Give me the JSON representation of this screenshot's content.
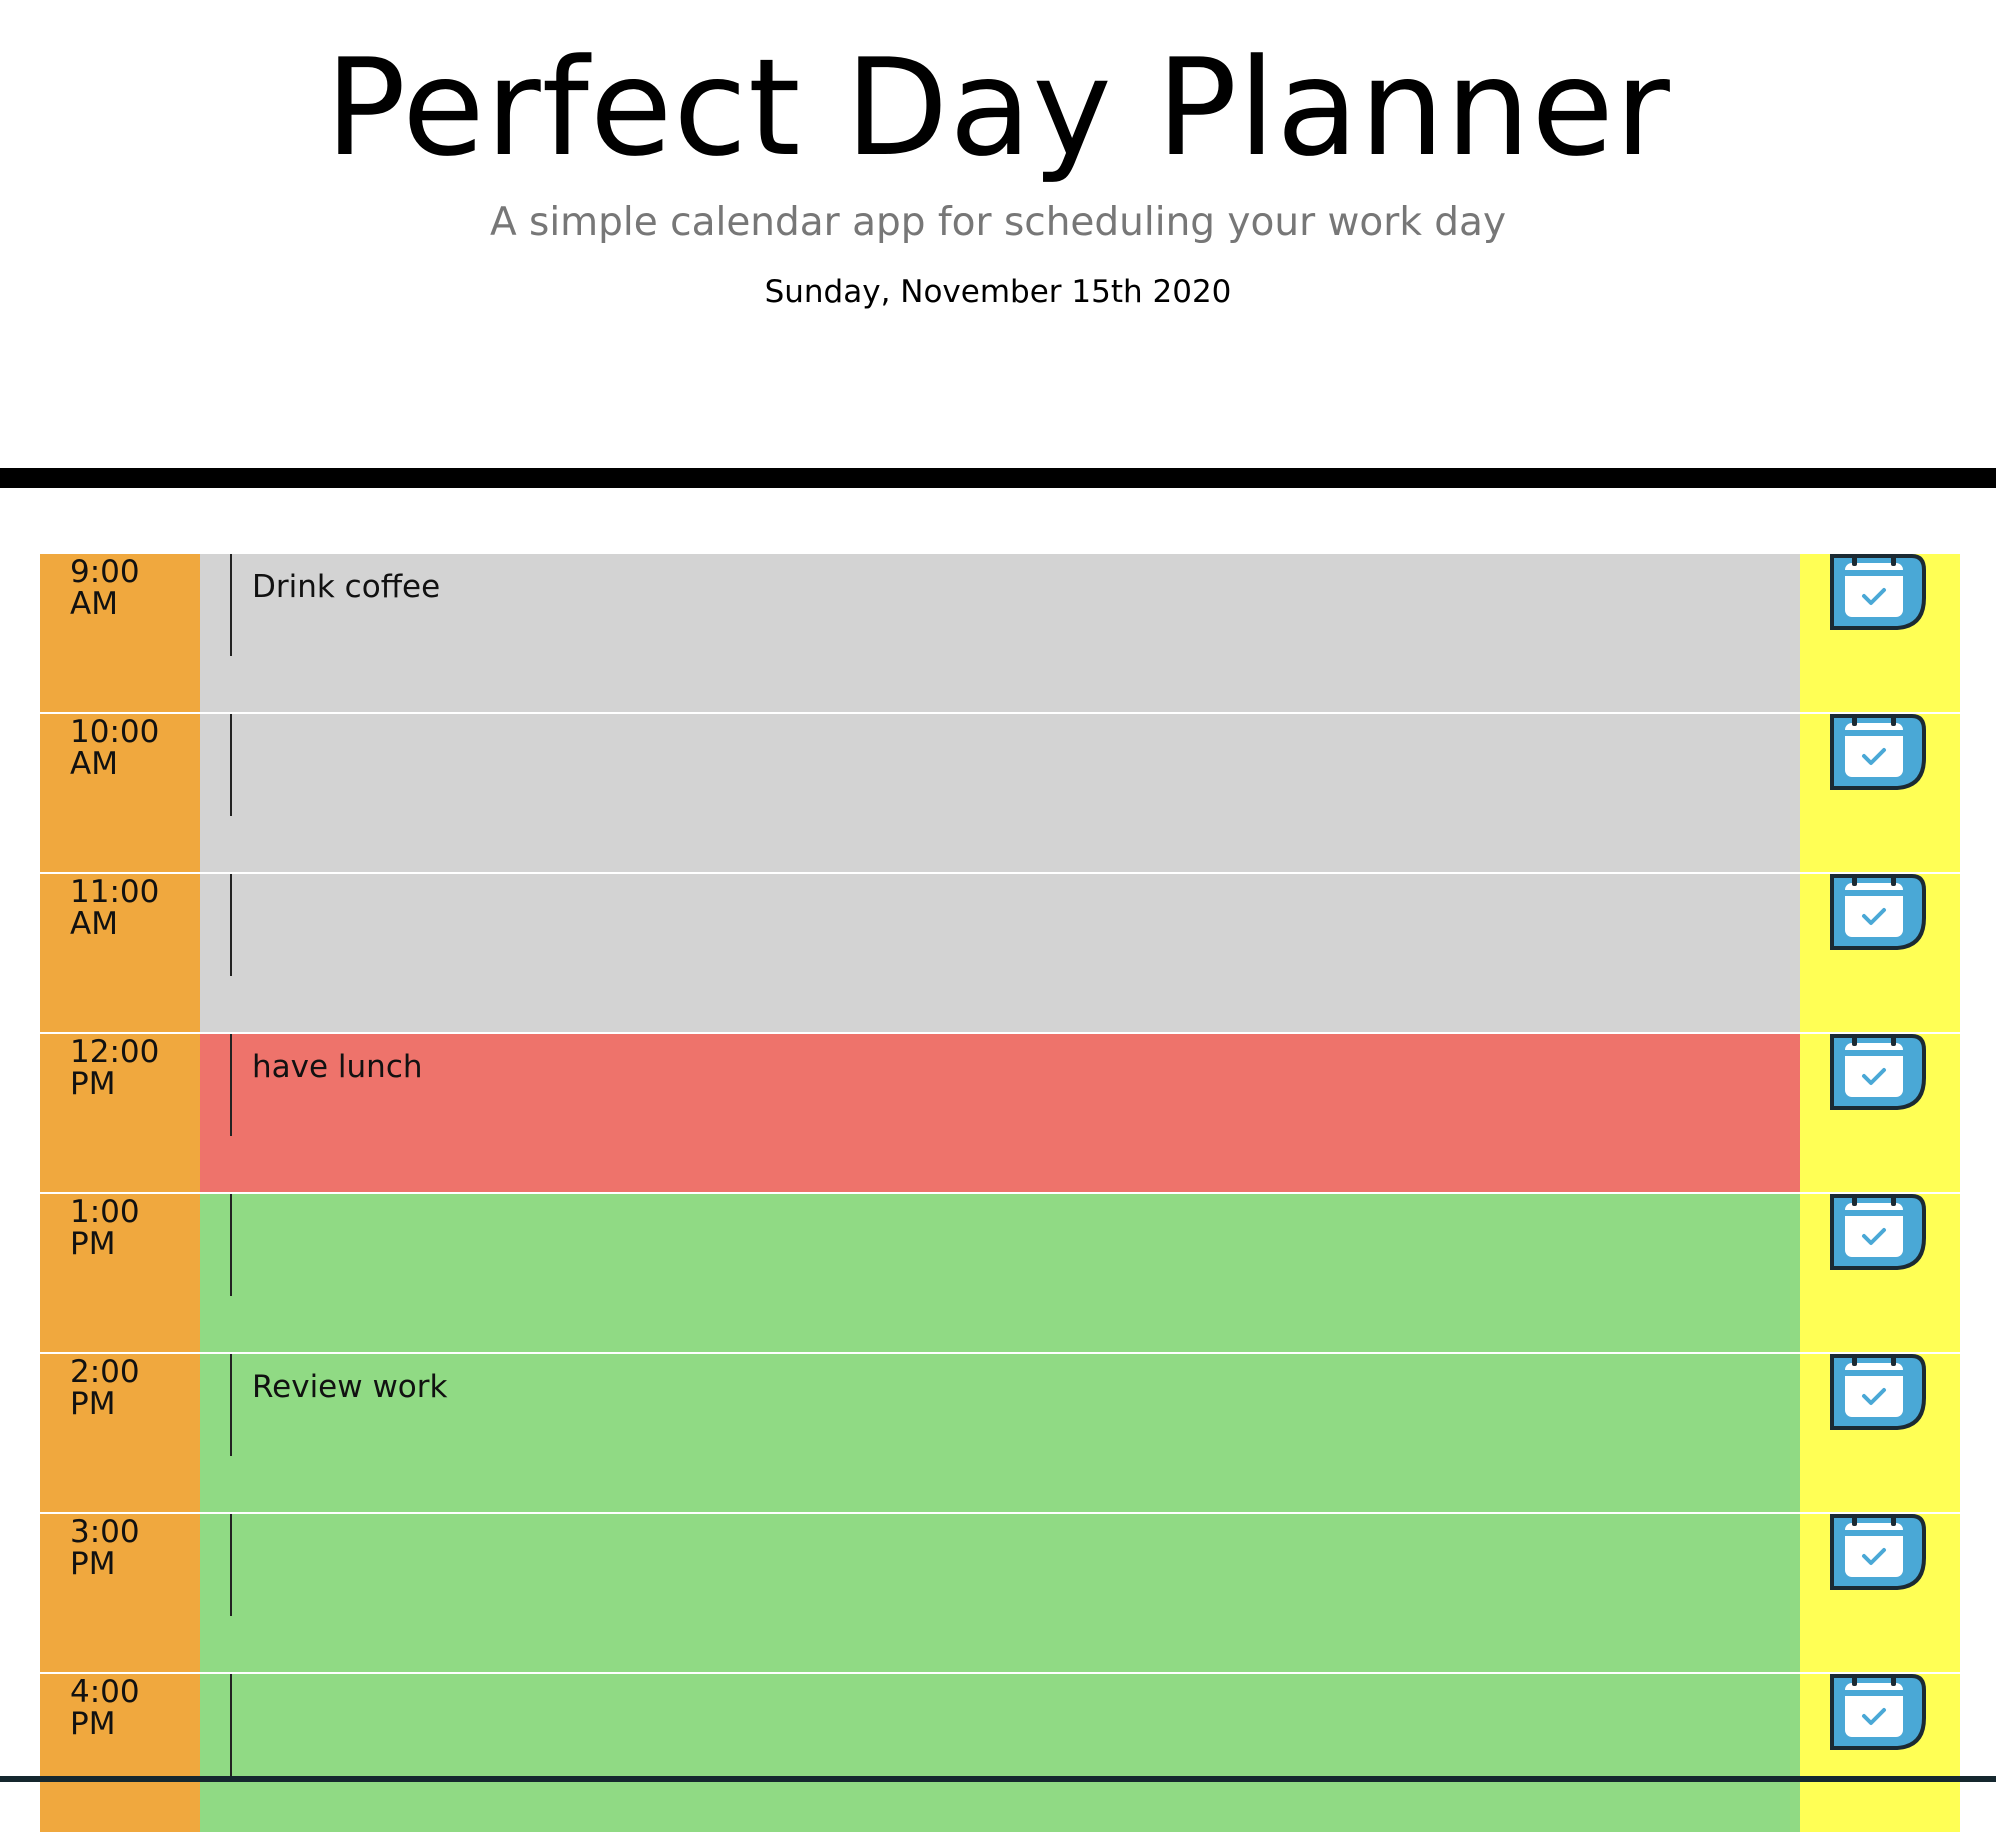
{
  "header": {
    "title": "Perfect Day Planner",
    "subtitle": "A simple calendar app for scheduling your work day",
    "current_date": "Sunday, November 15th 2020"
  },
  "colors": {
    "hour_column": "#f0a83e",
    "past": "#d3d3d3",
    "present": "#ee736b",
    "future": "#90da84",
    "save_column": "#ffff55",
    "save_icon_fill": "#4aa8d6"
  },
  "planner": {
    "rows": [
      {
        "time": "9:00",
        "period": "AM",
        "state": "past",
        "text": "Drink coffee",
        "save_icon": "calendar-check-icon"
      },
      {
        "time": "10:00",
        "period": "AM",
        "state": "past",
        "text": "",
        "save_icon": "calendar-check-icon"
      },
      {
        "time": "11:00",
        "period": "AM",
        "state": "past",
        "text": "",
        "save_icon": "calendar-check-icon"
      },
      {
        "time": "12:00",
        "period": "PM",
        "state": "present",
        "text": "have lunch",
        "save_icon": "calendar-check-icon"
      },
      {
        "time": "1:00",
        "period": "PM",
        "state": "future",
        "text": "",
        "save_icon": "calendar-check-icon"
      },
      {
        "time": "2:00",
        "period": "PM",
        "state": "future",
        "text": "Review work",
        "save_icon": "calendar-check-icon"
      },
      {
        "time": "3:00",
        "period": "PM",
        "state": "future",
        "text": "",
        "save_icon": "calendar-check-icon"
      },
      {
        "time": "4:00",
        "period": "PM",
        "state": "future",
        "text": "",
        "save_icon": "calendar-check-icon"
      }
    ]
  }
}
